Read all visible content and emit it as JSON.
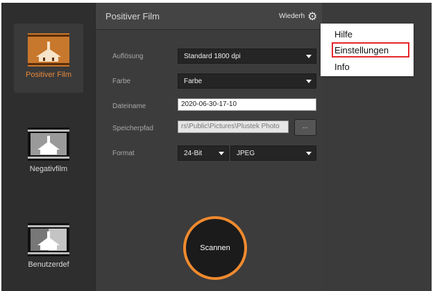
{
  "sidebar": {
    "items": [
      {
        "label": "Positiver Film",
        "active": true
      },
      {
        "label": "Negativfilm",
        "active": false
      },
      {
        "label": "Benutzerdef",
        "active": false
      }
    ]
  },
  "header": {
    "title": "Positiver Film",
    "action_label": "Wiederh",
    "settings_icon": "gear-icon"
  },
  "form": {
    "resolution_label": "Auflösung",
    "resolution_value": "Standard 1800 dpi",
    "color_label": "Farbe",
    "color_value": "Farbe",
    "filename_label": "Dateiname",
    "filename_value": "2020-06-30-17-10",
    "path_label": "Speicherpfad",
    "path_value": "rs\\Public\\Pictures\\Plustek Photo",
    "browse_label": "...",
    "format_label": "Format",
    "bitdepth_value": "24-Bit",
    "filetype_value": "JPEG"
  },
  "scan": {
    "label": "Scannen"
  },
  "menu": {
    "items": [
      "Hilfe",
      "Einstellungen",
      "Info"
    ],
    "highlighted": "Einstellungen"
  },
  "colors": {
    "accent": "#f08a2e",
    "highlight_border": "#e4262b",
    "active_label": "#e8883a"
  }
}
